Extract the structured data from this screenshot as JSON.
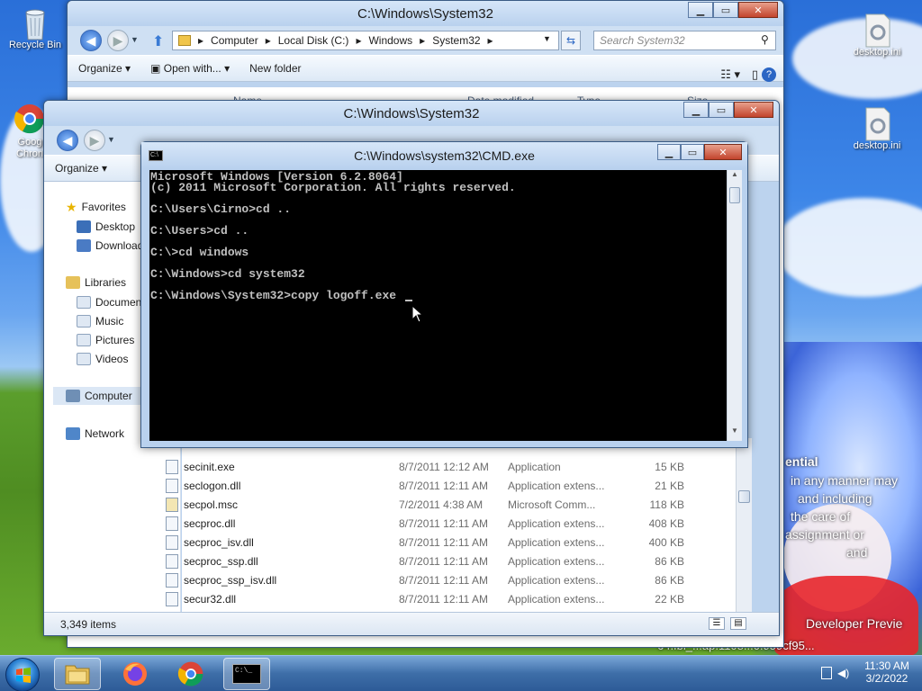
{
  "desktop": {
    "icons": [
      {
        "label": "Recycle Bin"
      },
      {
        "label": "Goog\nChron"
      },
      {
        "label": "desktop.ini"
      },
      {
        "label": "desktop.ini"
      }
    ],
    "overlay_lines": [
      "ential",
      "in any manner may",
      "and including",
      "the care of",
      "assignment or",
      "and",
      "Developer Previe",
      "64.fbl_...ap.1108...0.959cf95..."
    ]
  },
  "explorer_back": {
    "title": "C:\\Windows\\System32",
    "breadcrumb": [
      "Computer",
      "Local Disk (C:)",
      "Windows",
      "System32"
    ],
    "search_placeholder": "Search System32",
    "toolbar": {
      "organize": "Organize",
      "open_with": "Open with...",
      "new_folder": "New folder"
    },
    "columns": {
      "name": "Name",
      "date": "Date modified",
      "type": "Type",
      "size": "Size"
    }
  },
  "explorer_front": {
    "title": "C:\\Windows\\System32",
    "toolbar": {
      "organize": "Organize"
    },
    "nav": {
      "favorites": "Favorites",
      "desktop": "Desktop",
      "downloads": "Downloads",
      "libraries": "Libraries",
      "documents": "Documents",
      "music": "Music",
      "pictures": "Pictures",
      "videos": "Videos",
      "computer": "Computer",
      "network": "Network"
    },
    "files": [
      {
        "name": "secinit.exe",
        "date": "8/7/2011 12:12 AM",
        "type": "Application",
        "size": "15 KB"
      },
      {
        "name": "seclogon.dll",
        "date": "8/7/2011 12:11 AM",
        "type": "Application extens...",
        "size": "21 KB"
      },
      {
        "name": "secpol.msc",
        "date": "7/2/2011 4:38 AM",
        "type": "Microsoft Comm...",
        "size": "118 KB"
      },
      {
        "name": "secproc.dll",
        "date": "8/7/2011 12:11 AM",
        "type": "Application extens...",
        "size": "408 KB"
      },
      {
        "name": "secproc_isv.dll",
        "date": "8/7/2011 12:11 AM",
        "type": "Application extens...",
        "size": "400 KB"
      },
      {
        "name": "secproc_ssp.dll",
        "date": "8/7/2011 12:11 AM",
        "type": "Application extens...",
        "size": "86 KB"
      },
      {
        "name": "secproc_ssp_isv.dll",
        "date": "8/7/2011 12:11 AM",
        "type": "Application extens...",
        "size": "86 KB"
      },
      {
        "name": "secur32.dll",
        "date": "8/7/2011 12:11 AM",
        "type": "Application extens...",
        "size": "22 KB"
      }
    ],
    "status": "3,349 items"
  },
  "cmd": {
    "title": "C:\\Windows\\system32\\CMD.exe",
    "lines": [
      "Microsoft Windows [Version 6.2.8064]",
      "(c) 2011 Microsoft Corporation. All rights reserved.",
      "",
      "C:\\Users\\Cirno>cd ..",
      "",
      "C:\\Users>cd ..",
      "",
      "C:\\>cd windows",
      "",
      "C:\\Windows>cd system32",
      "",
      "C:\\Windows\\System32>copy logoff.exe "
    ]
  },
  "taskbar": {
    "time": "11:30 AM",
    "date": "3/2/2022",
    "apps": [
      "explorer-icon",
      "firefox-icon",
      "chrome-icon",
      "cmd-icon"
    ]
  },
  "colors": {
    "accent": "#2b66c4",
    "cmd_bg": "#000000",
    "cmd_text": "#c0c0c0"
  }
}
